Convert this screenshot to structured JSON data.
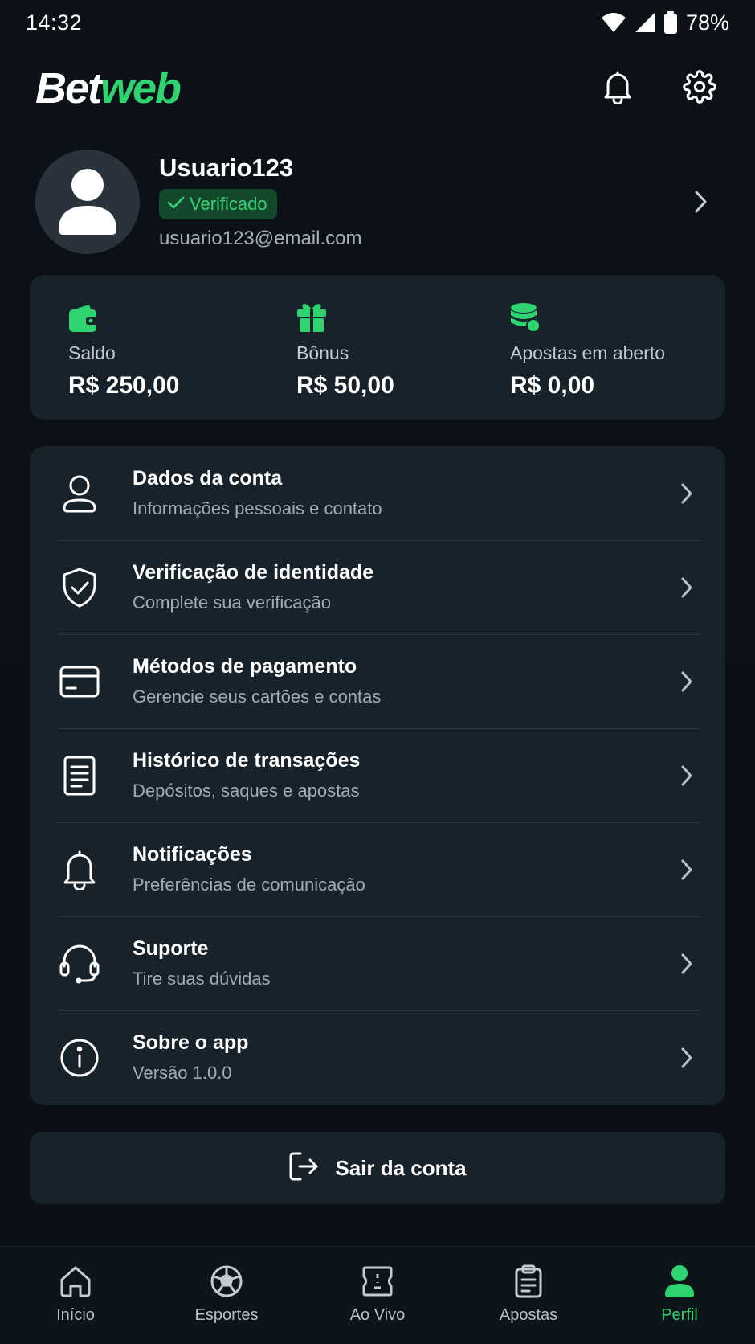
{
  "status_bar": {
    "time": "14:32",
    "battery": "78%"
  },
  "header": {
    "logo_part1": "Bet",
    "logo_part2": "web",
    "notification_icon": "bell-icon",
    "settings_icon": "gear-icon"
  },
  "profile": {
    "username": "Usuario123",
    "badge": "Verificado",
    "email": "usuario123@email.com"
  },
  "balances": [
    {
      "icon": "wallet-icon",
      "label": "Saldo",
      "value": "R$ 250,00"
    },
    {
      "icon": "gift-icon",
      "label": "Bônus",
      "value": "R$ 50,00"
    },
    {
      "icon": "coins-icon",
      "label": "Apostas em aberto",
      "value": "R$ 0,00"
    }
  ],
  "menu": [
    {
      "icon": "user-icon",
      "title": "Dados da conta",
      "subtitle": "Informações pessoais e contato"
    },
    {
      "icon": "shield-check-icon",
      "title": "Verificação de identidade",
      "subtitle": "Complete sua verificação"
    },
    {
      "icon": "credit-card-icon",
      "title": "Métodos de pagamento",
      "subtitle": "Gerencie seus cartões e contas"
    },
    {
      "icon": "document-icon",
      "title": "Histórico de transações",
      "subtitle": "Depósitos, saques e apostas"
    },
    {
      "icon": "bell-icon",
      "title": "Notificações",
      "subtitle": "Preferências de comunicação"
    },
    {
      "icon": "headset-icon",
      "title": "Suporte",
      "subtitle": "Tire suas dúvidas"
    },
    {
      "icon": "info-icon",
      "title": "Sobre o app",
      "subtitle": "Versão 1.0.0"
    }
  ],
  "logout": {
    "label": "Sair da conta",
    "icon": "logout-icon"
  },
  "bottom_nav": [
    {
      "icon": "home-icon",
      "label": "Início",
      "active": false
    },
    {
      "icon": "soccer-ball-icon",
      "label": "Esportes",
      "active": false
    },
    {
      "icon": "ticket-icon",
      "label": "Ao Vivo",
      "active": false
    },
    {
      "icon": "clipboard-icon",
      "label": "Apostas",
      "active": false
    },
    {
      "icon": "profile-icon",
      "label": "Perfil",
      "active": true
    }
  ],
  "colors": {
    "accent": "#2fd36f",
    "background": "#0a1016",
    "card": "#17222b",
    "badge_bg": "#14482d"
  }
}
